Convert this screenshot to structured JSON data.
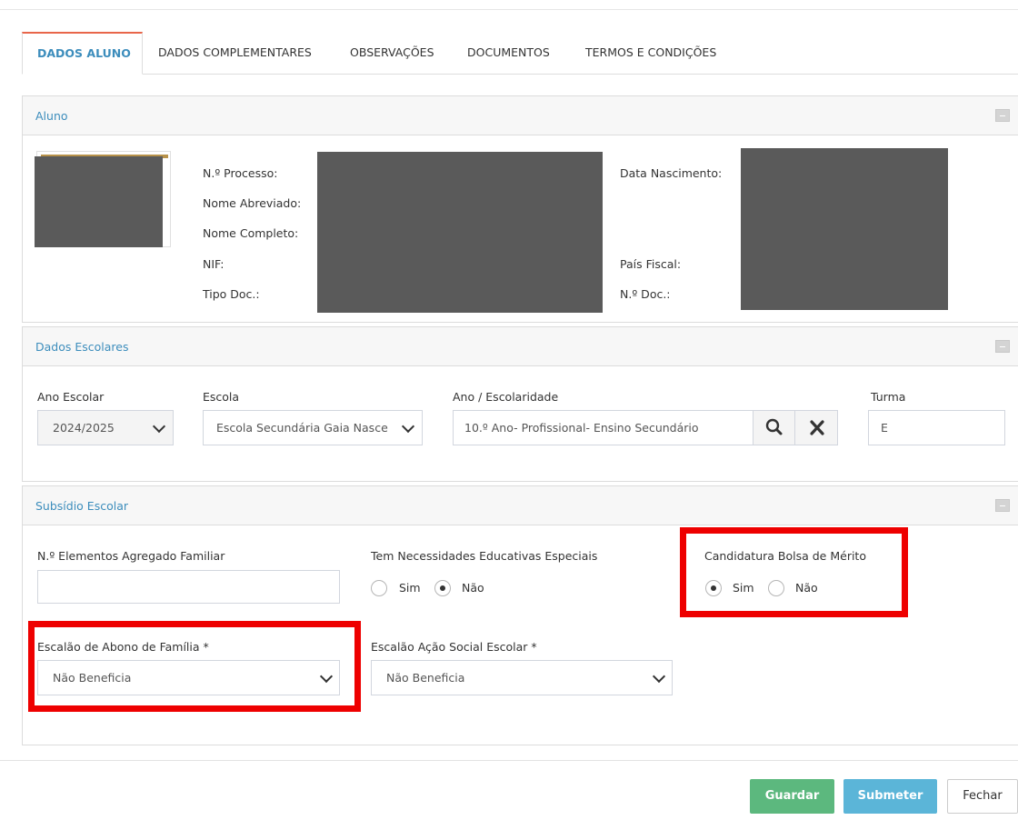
{
  "tabs": [
    {
      "label": "DADOS ALUNO",
      "active": true
    },
    {
      "label": "DADOS COMPLEMENTARES"
    },
    {
      "label": "OBSERVAÇÕES"
    },
    {
      "label": "DOCUMENTOS"
    },
    {
      "label": "TERMOS E CONDIÇÕES"
    }
  ],
  "aluno": {
    "title": "Aluno",
    "labels": {
      "processo": "N.º Processo:",
      "nome_abreviado": "Nome Abreviado:",
      "nome_completo": "Nome Completo:",
      "nif": "NIF:",
      "tipo_doc": "Tipo Doc.:",
      "data_nascimento": "Data Nascimento:",
      "pais_fiscal": "País Fiscal:",
      "num_doc": "N.º Doc.:"
    }
  },
  "escolares": {
    "title": "Dados Escolares",
    "ano_escolar": {
      "label": "Ano Escolar",
      "value": "2024/2025"
    },
    "escola": {
      "label": "Escola",
      "value": "Escola Secundária Gaia Nasce"
    },
    "escolaridade": {
      "label": "Ano / Escolaridade",
      "value": "10.º Ano- Profissional- Ensino Secundário"
    },
    "turma": {
      "label": "Turma",
      "value": "E"
    }
  },
  "subsidio": {
    "title": "Subsídio Escolar",
    "agregado": {
      "label": "N.º Elementos Agregado Familiar",
      "value": ""
    },
    "nee": {
      "label": "Tem Necessidades Educativas Especiais",
      "sim": "Sim",
      "nao": "Não",
      "selected": "nao"
    },
    "bolsa": {
      "label": "Candidatura Bolsa de Mérito",
      "sim": "Sim",
      "nao": "Não",
      "selected": "sim"
    },
    "abono": {
      "label": "Escalão de Abono de Família *",
      "value": "Não Beneficia"
    },
    "ase": {
      "label": "Escalão Ação Social Escolar *",
      "value": "Não Beneficia"
    }
  },
  "buttons": {
    "guardar": "Guardar",
    "submeter": "Submeter",
    "fechar": "Fechar"
  },
  "colors": {
    "accent": "#3c8dbc",
    "tab_active_top": "#e8664a",
    "guardar": "#5cb87e",
    "submeter": "#5bb5d8",
    "highlight": "#ee0000"
  },
  "icons": {
    "search": "search-icon",
    "clear": "close-icon",
    "chevron": "chevron-down-icon",
    "collapse": "minus-icon"
  }
}
